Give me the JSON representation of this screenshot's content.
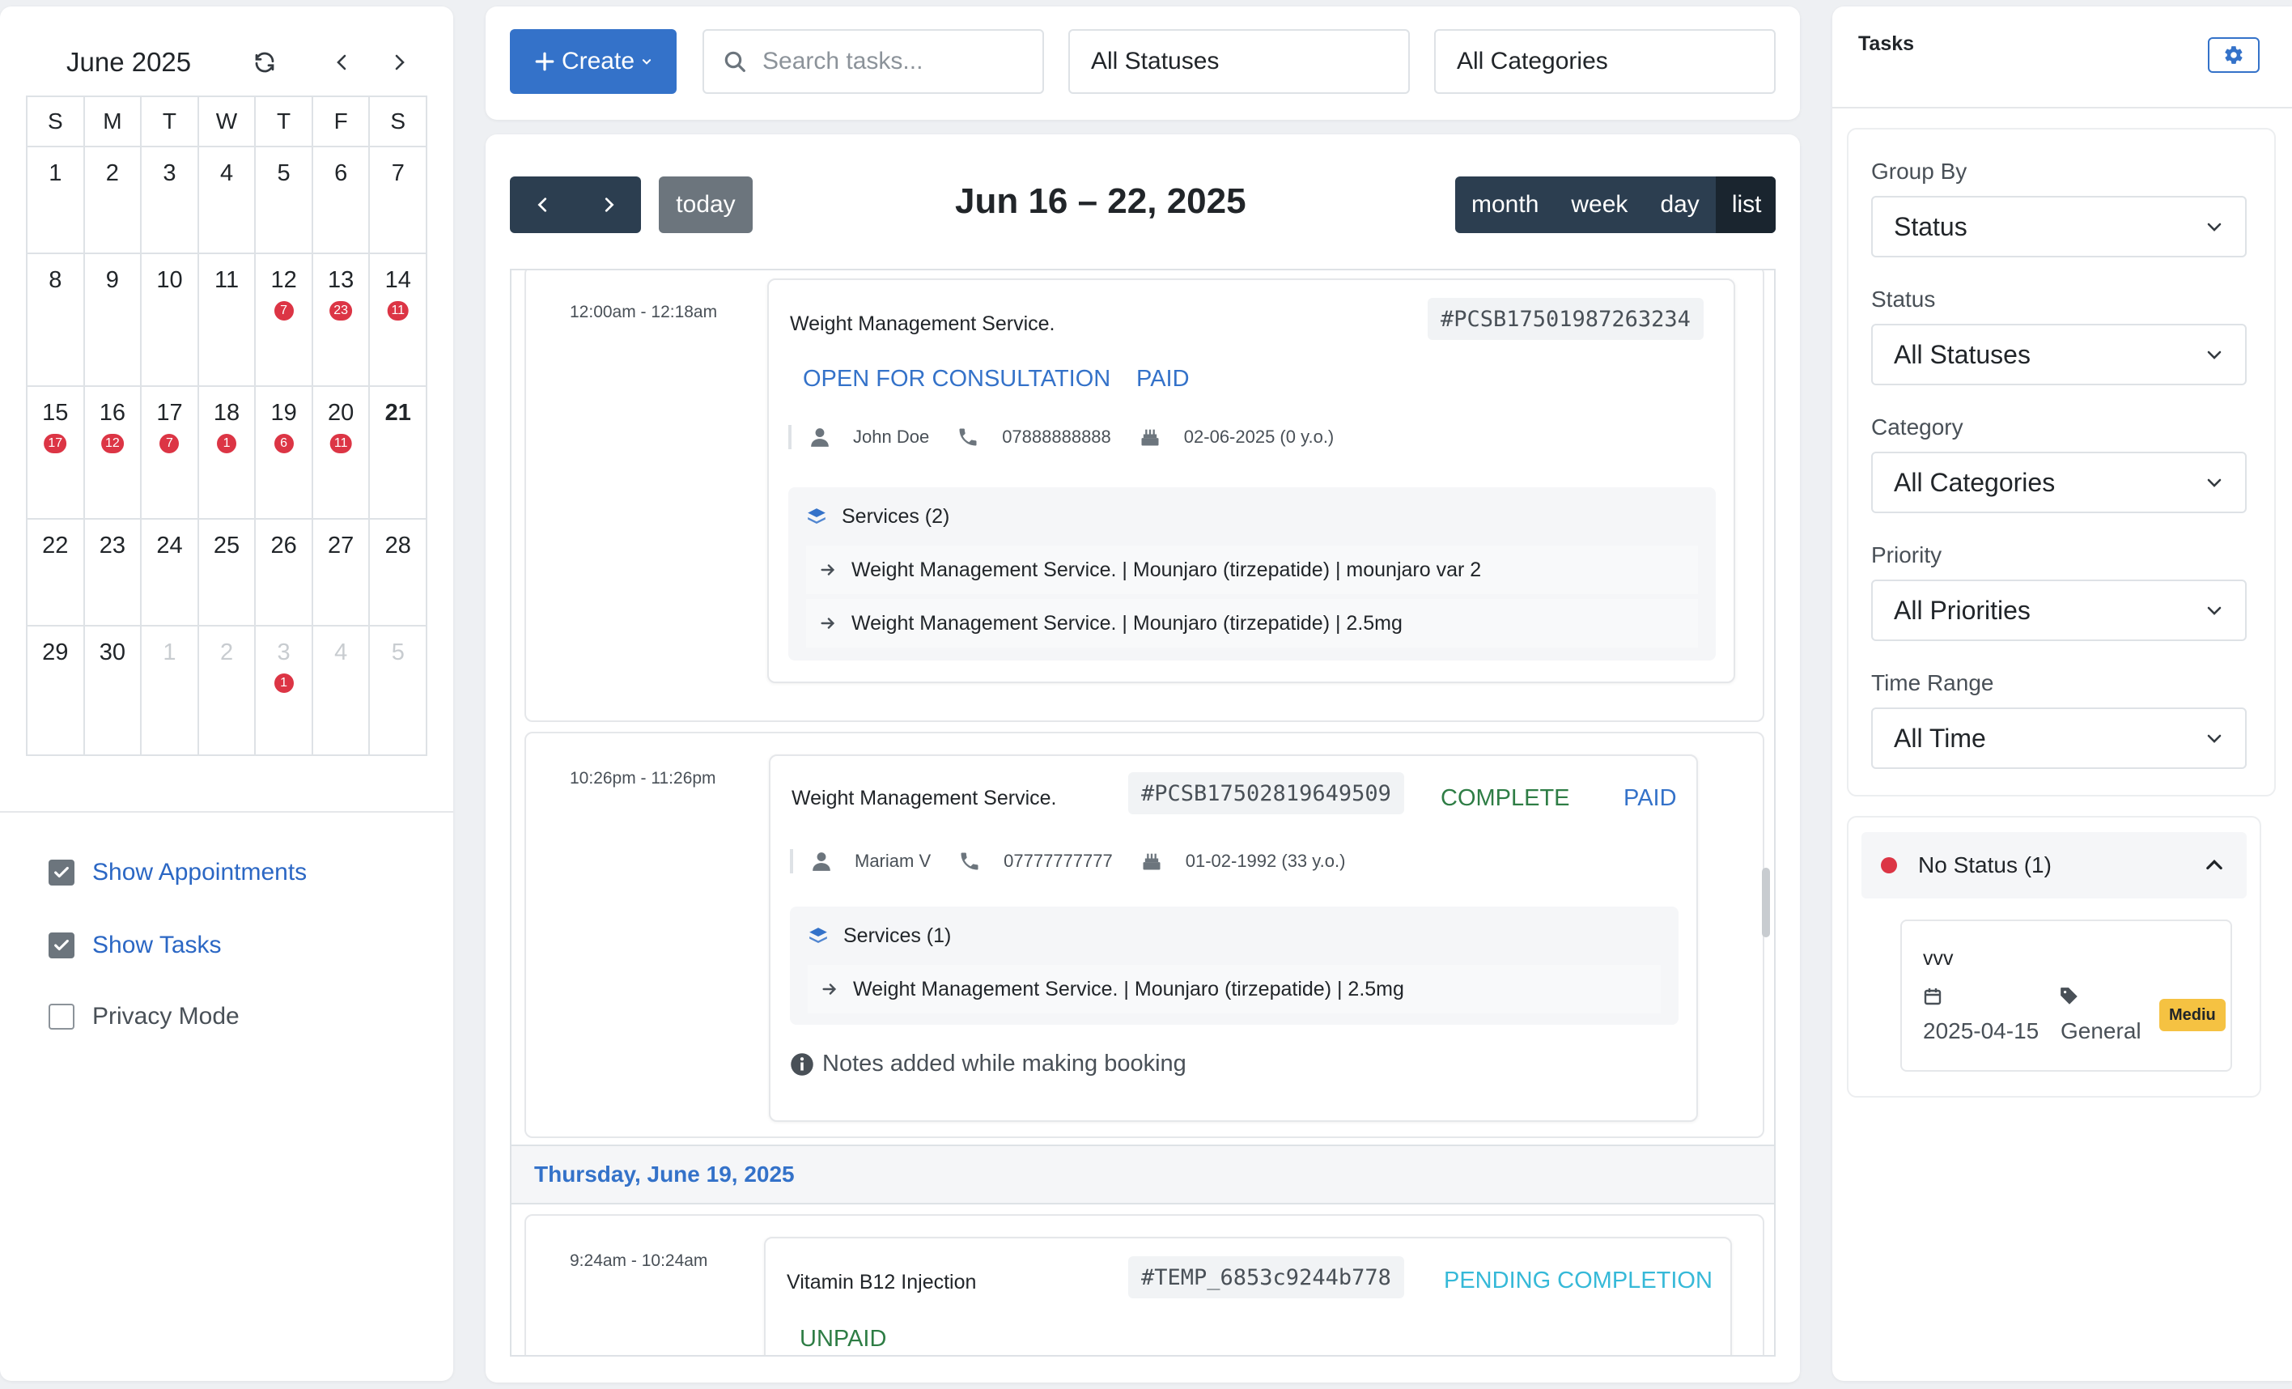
{
  "mini_calendar": {
    "title": "June 2025",
    "dow": [
      "S",
      "M",
      "T",
      "W",
      "T",
      "F",
      "S"
    ],
    "weeks": [
      [
        {
          "d": "1"
        },
        {
          "d": "2"
        },
        {
          "d": "3"
        },
        {
          "d": "4"
        },
        {
          "d": "5"
        },
        {
          "d": "6"
        },
        {
          "d": "7"
        }
      ],
      [
        {
          "d": "8"
        },
        {
          "d": "9"
        },
        {
          "d": "10"
        },
        {
          "d": "11"
        },
        {
          "d": "12",
          "b": "7"
        },
        {
          "d": "13",
          "b": "23"
        },
        {
          "d": "14",
          "b": "11"
        }
      ],
      [
        {
          "d": "15",
          "b": "17"
        },
        {
          "d": "16",
          "b": "12"
        },
        {
          "d": "17",
          "b": "7"
        },
        {
          "d": "18",
          "b": "1"
        },
        {
          "d": "19",
          "b": "6"
        },
        {
          "d": "20",
          "b": "11"
        },
        {
          "d": "21",
          "today": true
        }
      ],
      [
        {
          "d": "22"
        },
        {
          "d": "23"
        },
        {
          "d": "24"
        },
        {
          "d": "25"
        },
        {
          "d": "26"
        },
        {
          "d": "27"
        },
        {
          "d": "28"
        }
      ],
      [
        {
          "d": "29"
        },
        {
          "d": "30"
        },
        {
          "d": "1",
          "other": true
        },
        {
          "d": "2",
          "other": true
        },
        {
          "d": "3",
          "other": true,
          "b": "1"
        },
        {
          "d": "4",
          "other": true
        },
        {
          "d": "5",
          "other": true
        }
      ]
    ]
  },
  "toggles": {
    "appointments": {
      "label": "Show Appointments",
      "checked": true
    },
    "tasks": {
      "label": "Show Tasks",
      "checked": true
    },
    "privacy": {
      "label": "Privacy Mode",
      "checked": false
    }
  },
  "toolbar": {
    "create_label": "Create",
    "search_placeholder": "Search tasks...",
    "status_filter": "All Statuses",
    "category_filter": "All Categories"
  },
  "calendar": {
    "today_label": "today",
    "range_title": "Jun 16 – 22, 2025",
    "views": [
      "month",
      "week",
      "day",
      "list"
    ],
    "active_view": "list"
  },
  "events": [
    {
      "time": "12:00am - 12:18am",
      "title": "Weight Management Service.",
      "ref": "#PCSB17501987263234",
      "status": "OPEN FOR CONSULTATION",
      "payment": "PAID",
      "patient": "John Doe",
      "phone": "07888888888",
      "dob": "02-06-2025 (0 y.o.)",
      "services_label": "Services (2)",
      "services": [
        "Weight Management Service. | Mounjaro (tirzepatide) | mounjaro var 2",
        "Weight Management Service. | Mounjaro (tirzepatide) | 2.5mg"
      ]
    },
    {
      "time": "10:26pm - 11:26pm",
      "title": "Weight Management Service.",
      "ref": "#PCSB17502819649509",
      "status": "COMPLETE",
      "payment": "PAID",
      "patient": "Mariam V",
      "phone": "07777777777",
      "dob": "01-02-1992 (33 y.o.)",
      "services_label": "Services (1)",
      "services": [
        "Weight Management Service. | Mounjaro (tirzepatide) | 2.5mg"
      ],
      "notes": "Notes added while making booking"
    },
    {
      "time": "9:24am - 10:24am",
      "title": "Vitamin B12 Injection",
      "ref": "#TEMP_6853c9244b778",
      "status": "PENDING COMPLETION",
      "payment": "UNPAID"
    }
  ],
  "date_heading": "Thursday, June 19, 2025",
  "tasks_panel": {
    "title": "Tasks",
    "filters": [
      {
        "label": "Group By",
        "value": "Status"
      },
      {
        "label": "Status",
        "value": "All Statuses"
      },
      {
        "label": "Category",
        "value": "All Categories"
      },
      {
        "label": "Priority",
        "value": "All Priorities"
      },
      {
        "label": "Time Range",
        "value": "All Time"
      }
    ],
    "group": {
      "label": "No Status (1)",
      "color": "#dc3545"
    },
    "task": {
      "title": "vvv",
      "date": "2025-04-15",
      "category": "General",
      "priority": "Mediu"
    }
  },
  "colors": {
    "primary": "#3472c9",
    "nav_dark": "#2c3e50",
    "danger": "#dc3545",
    "success": "#2e7d45",
    "info": "#36b9d8",
    "warning": "#f5c242"
  }
}
